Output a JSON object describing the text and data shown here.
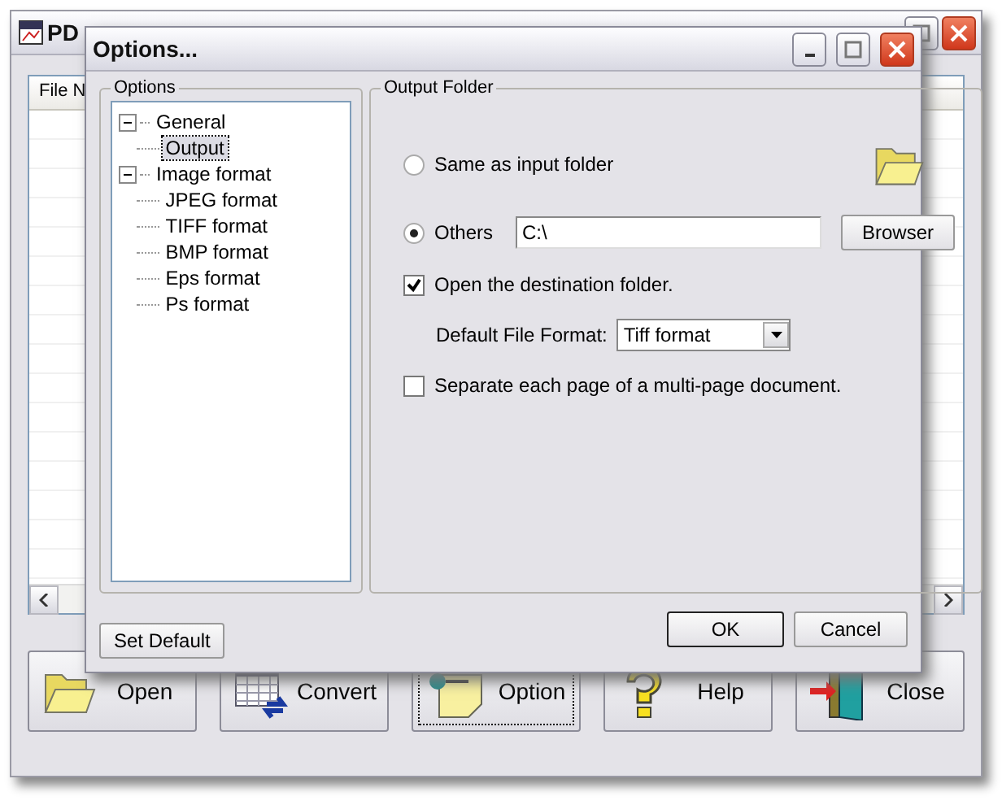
{
  "main_window": {
    "title": "PD",
    "list": {
      "columns": [
        "File N"
      ]
    },
    "buttons": [
      {
        "label": "Open",
        "focused": false
      },
      {
        "label": "Convert",
        "focused": false
      },
      {
        "label": "Option",
        "focused": true
      },
      {
        "label": "Help",
        "focused": false
      },
      {
        "label": "Close",
        "focused": false
      }
    ]
  },
  "dialog": {
    "title": "Options...",
    "tree": {
      "label": "Options",
      "items": [
        {
          "label": "General",
          "expanded": true,
          "selected": false,
          "children": [
            {
              "label": "Output",
              "selected": true
            }
          ]
        },
        {
          "label": "Image format",
          "expanded": true,
          "selected": false,
          "children": [
            {
              "label": "JPEG format",
              "selected": false
            },
            {
              "label": "TIFF format",
              "selected": false
            },
            {
              "label": "BMP format",
              "selected": false
            },
            {
              "label": "Eps format",
              "selected": false
            },
            {
              "label": "Ps format",
              "selected": false
            }
          ]
        }
      ]
    },
    "output": {
      "label": "Output Folder",
      "radios": [
        {
          "label": "Same as input folder",
          "selected": false
        },
        {
          "label": "Others",
          "selected": true
        }
      ],
      "path": "C:\\",
      "browse": "Browser",
      "open_destination": {
        "label": "Open the destination folder.",
        "checked": true
      },
      "format": {
        "label": "Default File Format:",
        "value": "Tiff format"
      },
      "separate": {
        "label": "Separate each page of a multi-page document.",
        "checked": false
      }
    },
    "set_default": "Set Default",
    "ok": "OK",
    "cancel": "Cancel"
  }
}
